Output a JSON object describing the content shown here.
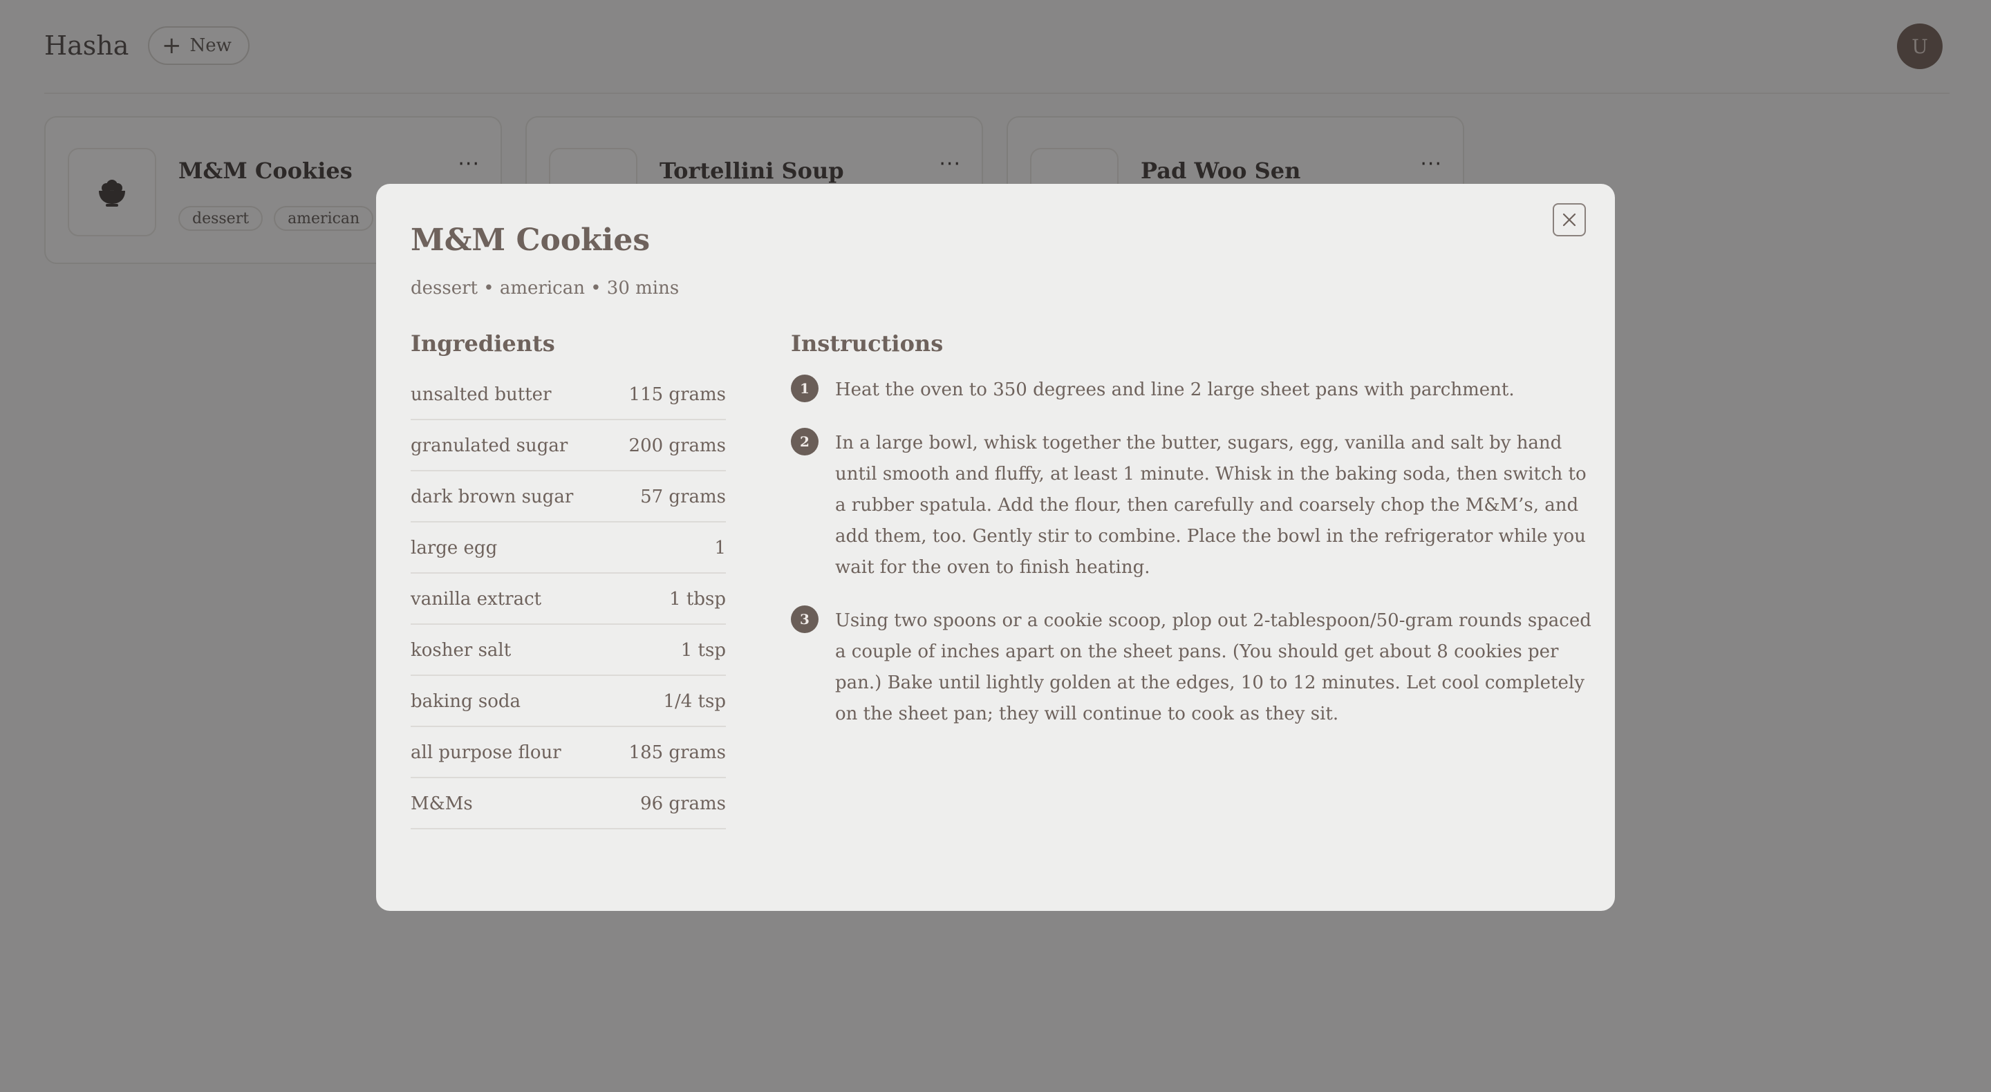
{
  "app": {
    "title": "Hasha",
    "new_button_label": "New",
    "avatar_initial": "U"
  },
  "cards": [
    {
      "title": "M&M Cookies",
      "tags": [
        "dessert",
        "american"
      ],
      "icon": "bowl-icon"
    },
    {
      "title": "Tortellini Soup",
      "tags": [],
      "icon": "bowl-icon"
    },
    {
      "title": "Pad Woo Sen",
      "tags": [],
      "icon": "bowl-icon"
    }
  ],
  "modal": {
    "title": "M&M Cookies",
    "meta": "dessert • american • 30 mins",
    "ingredients_heading": "Ingredients",
    "instructions_heading": "Instructions",
    "ingredients": [
      {
        "name": "unsalted butter",
        "amount": "115 grams"
      },
      {
        "name": "granulated sugar",
        "amount": "200 grams"
      },
      {
        "name": "dark brown sugar",
        "amount": "57 grams"
      },
      {
        "name": "large egg",
        "amount": "1"
      },
      {
        "name": "vanilla extract",
        "amount": "1 tbsp"
      },
      {
        "name": "kosher salt",
        "amount": "1 tsp"
      },
      {
        "name": "baking soda",
        "amount": "1/4 tsp"
      },
      {
        "name": "all purpose flour",
        "amount": "185 grams"
      },
      {
        "name": "M&Ms",
        "amount": "96 grams"
      }
    ],
    "steps": [
      {
        "number": "1",
        "text": "Heat the oven to 350 degrees and line 2 large sheet pans with parchment."
      },
      {
        "number": "2",
        "text": "In a large bowl, whisk together the butter, sugars, egg, vanilla and salt by hand until smooth and fluffy, at least 1 minute. Whisk in the baking soda, then switch to a rubber spatula. Add the flour, then carefully and coarsely chop the M&M’s, and add them, too. Gently stir to combine. Place the bowl in the refrigerator while you wait for the oven to finish heating."
      },
      {
        "number": "3",
        "text": "Using two spoons or a cookie scoop, plop out 2-tablespoon/50-gram rounds spaced a couple of inches apart on the sheet pans. (You should get about 8 cookies per pan.) Bake until lightly golden at the edges, 10 to 12 minutes. Let cool completely on the sheet pan; they will continue to cook as they sit."
      }
    ]
  }
}
